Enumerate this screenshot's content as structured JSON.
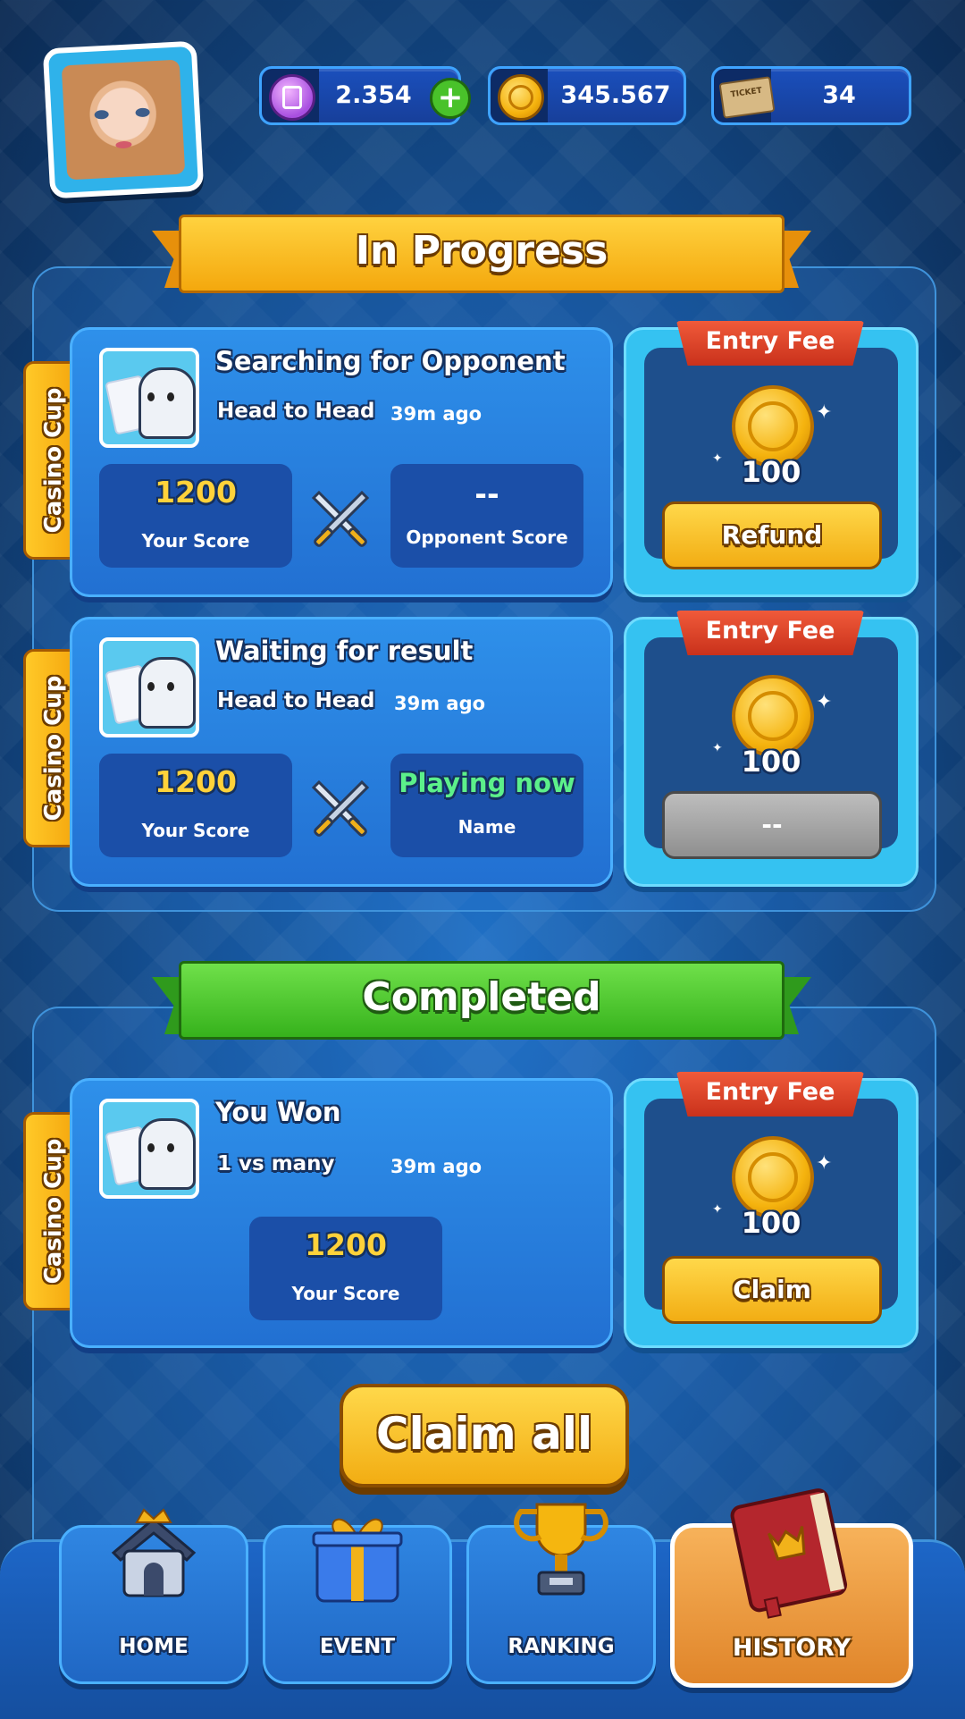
{
  "header": {
    "currencies": [
      {
        "icon": "gem-coin-icon",
        "value": "2.354"
      },
      {
        "icon": "gold-coin-icon",
        "value": "345.567"
      },
      {
        "icon": "ticket-icon",
        "value": "34",
        "ticket_text": "TICKET"
      }
    ]
  },
  "in_progress": {
    "title": "In Progress",
    "cards": [
      {
        "tag": "Casino Cup",
        "title": "Searching for Opponent",
        "mode": "Head to Head",
        "time": "39m ago",
        "your_score": "1200",
        "your_score_label": "Your Score",
        "opponent_value": "--",
        "opponent_label": "Opponent Score",
        "fee_label": "Entry Fee",
        "fee_amount": "100",
        "button": "Refund"
      },
      {
        "tag": "Casino Cup",
        "title": "Waiting for result",
        "mode": "Head to Head",
        "time": "39m ago",
        "your_score": "1200",
        "your_score_label": "Your Score",
        "opponent_value": "Playing now",
        "opponent_label": "Name",
        "fee_label": "Entry Fee",
        "fee_amount": "100",
        "button": "--"
      }
    ]
  },
  "completed": {
    "title": "Completed",
    "cards": [
      {
        "tag": "Casino Cup",
        "title": "You Won",
        "mode": "1 vs many",
        "time": "39m ago",
        "your_score": "1200",
        "your_score_label": "Your Score",
        "fee_label": "Entry Fee",
        "fee_amount": "100",
        "button": "Claim"
      }
    ],
    "claim_all": "Claim all"
  },
  "nav": {
    "items": [
      {
        "label": "HOME",
        "icon": "home-icon"
      },
      {
        "label": "EVENT",
        "icon": "gift-icon"
      },
      {
        "label": "RANKING",
        "icon": "trophy-icon"
      },
      {
        "label": "HISTORY",
        "icon": "book-icon"
      }
    ],
    "active": "HISTORY"
  },
  "colors": {
    "score_yellow": "#ffd23a",
    "playing_green": "#5cf08a",
    "accent_orange": "#f2ad13"
  }
}
